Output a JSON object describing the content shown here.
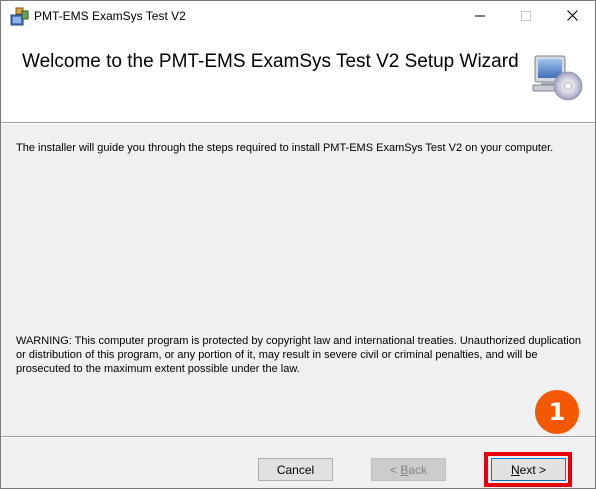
{
  "window": {
    "title": "PMT-EMS ExamSys Test V2",
    "icon": "installer-package-icon"
  },
  "header": {
    "title": "Welcome to the PMT-EMS ExamSys Test V2 Setup Wizard",
    "icon": "setup-computer-disc-icon"
  },
  "content": {
    "intro": "The installer will guide you through the steps required to install PMT-EMS ExamSys Test V2 on your computer.",
    "warning": "WARNING: This computer program is protected by copyright law and international treaties. Unauthorized duplication or distribution of this program, or any portion of it, may result in severe civil or criminal penalties, and will be prosecuted to the maximum extent possible under the law."
  },
  "annotation": {
    "step_number": "1",
    "color": "#f35800",
    "highlight_color": "#e8000b"
  },
  "buttons": {
    "cancel": {
      "label": "Cancel",
      "mnemonic": ""
    },
    "back": {
      "mnemonic": "B",
      "rest": "ack",
      "prefix": "< ",
      "enabled": false
    },
    "next": {
      "mnemonic": "N",
      "rest": "ext >",
      "enabled": true
    }
  },
  "controls": {
    "minimize_icon": "minimize-icon",
    "maximize_icon": "maximize-icon",
    "close_icon": "close-icon"
  }
}
